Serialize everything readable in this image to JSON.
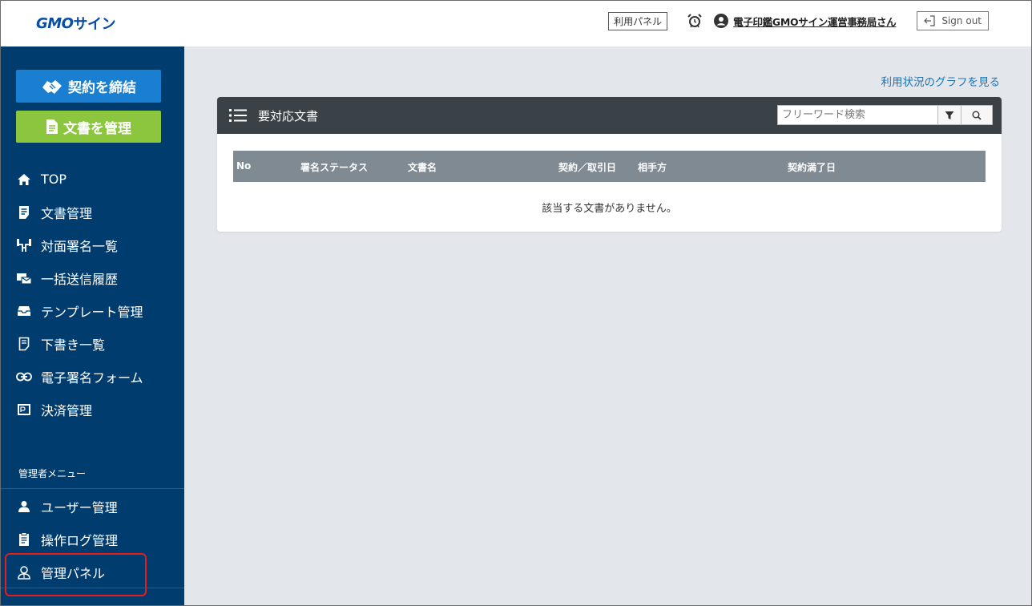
{
  "header": {
    "logo_main": "GMO",
    "logo_sub": "サイン",
    "panel_label": "利用パネル",
    "alarm_icon": "alarm-clock-icon",
    "user_name": "電子印鑑GMOサイン運営事務局さん",
    "signout_label": "Sign out"
  },
  "sidebar": {
    "contract_button": "契約を締結",
    "docs_button": "文書を管理",
    "items": [
      {
        "label": "TOP",
        "icon": "home-icon"
      },
      {
        "label": "文書管理",
        "icon": "document-icon"
      },
      {
        "label": "対面署名一覧",
        "icon": "face-to-face-icon"
      },
      {
        "label": "一括送信履歴",
        "icon": "bulk-send-icon"
      },
      {
        "label": "テンプレート管理",
        "icon": "template-icon"
      },
      {
        "label": "下書き一覧",
        "icon": "draft-icon"
      },
      {
        "label": "電子署名フォーム",
        "icon": "link-icon"
      },
      {
        "label": "決済管理",
        "icon": "pay-icon"
      }
    ],
    "admin_label": "管理者メニュー",
    "admin_items": [
      {
        "label": "ユーザー管理",
        "icon": "user-icon"
      },
      {
        "label": "操作ログ管理",
        "icon": "log-icon"
      },
      {
        "label": "管理パネル",
        "icon": "admin-panel-icon"
      }
    ]
  },
  "main": {
    "graph_link": "利用状況のグラフを見る",
    "card_title": "要対応文書",
    "search_placeholder": "フリーワード検索",
    "columns": [
      "No",
      "署名ステータス",
      "文書名",
      "契約／取引日",
      "相手方",
      "契約満了日"
    ],
    "empty_message": "該当する文書がありません。"
  },
  "colors": {
    "sidebar_bg": "#003d6e",
    "contract_button": "#1a7fd1",
    "docs_button": "#8cc63e",
    "highlight": "#e81c1c"
  }
}
